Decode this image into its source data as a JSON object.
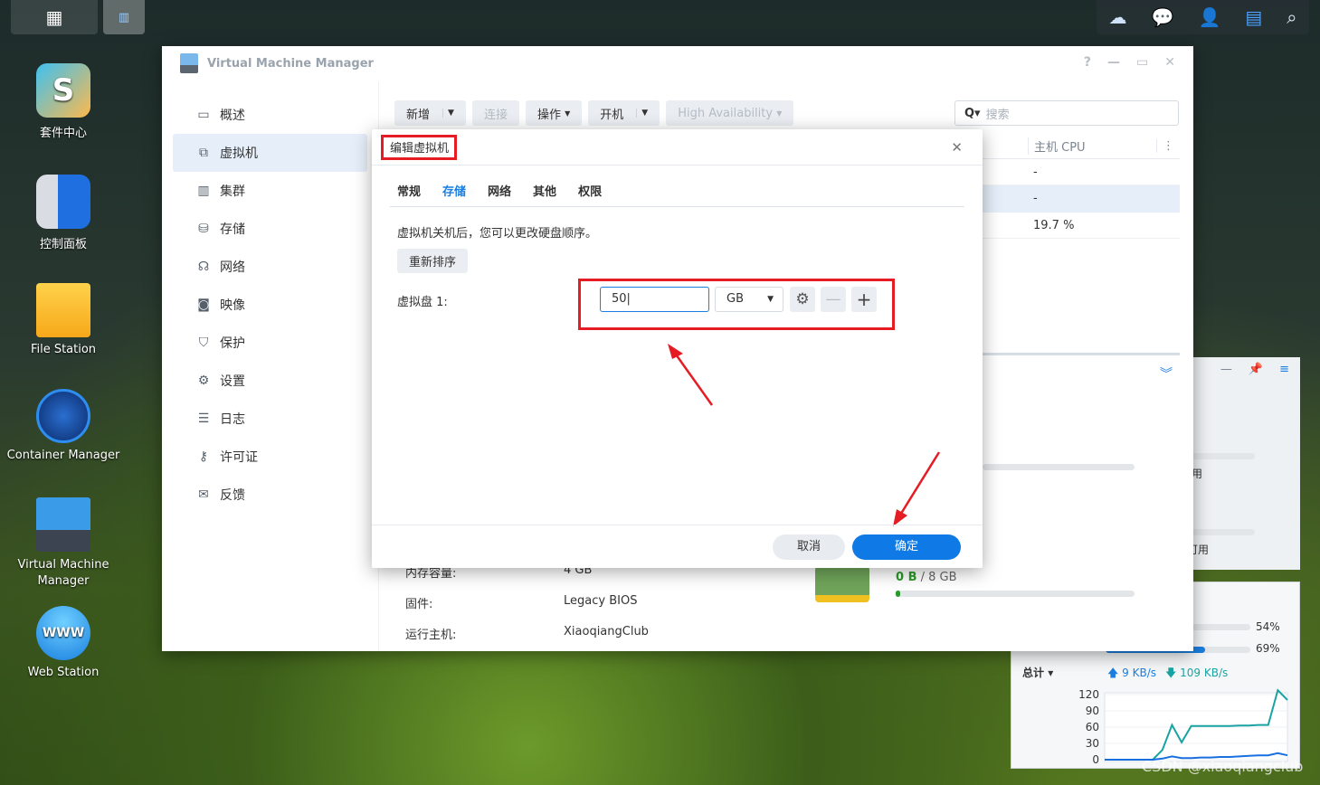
{
  "taskbar": {
    "tray_icons": [
      "cloud-sync-icon",
      "chat-icon",
      "user-icon",
      "widgets-icon",
      "search-icon"
    ]
  },
  "desktop": {
    "icons": [
      {
        "label": "套件中心"
      },
      {
        "label": "控制面板"
      },
      {
        "label": "File Station"
      },
      {
        "label": "Container Manager"
      },
      {
        "label": "Virtual Machine Manager"
      },
      {
        "label": "Web Station"
      }
    ]
  },
  "window": {
    "title": "Virtual Machine Manager",
    "sidebar": [
      {
        "label": "概述",
        "icon": "overview-icon"
      },
      {
        "label": "虚拟机",
        "icon": "vm-icon",
        "active": true
      },
      {
        "label": "集群",
        "icon": "cluster-icon"
      },
      {
        "label": "存储",
        "icon": "storage-icon"
      },
      {
        "label": "网络",
        "icon": "network-icon"
      },
      {
        "label": "映像",
        "icon": "image-icon"
      },
      {
        "label": "保护",
        "icon": "shield-icon"
      },
      {
        "label": "设置",
        "icon": "gear-icon"
      },
      {
        "label": "日志",
        "icon": "list-icon"
      },
      {
        "label": "许可证",
        "icon": "key-icon"
      },
      {
        "label": "反馈",
        "icon": "mail-icon"
      }
    ],
    "toolbar": {
      "create": "新增",
      "connect": "连接",
      "action": "操作",
      "power_on": "开机",
      "ha": "High Availability",
      "search_placeholder": "搜索"
    },
    "table": {
      "col_host_cpu": "主机 CPU",
      "rows": [
        "-",
        "-",
        "19.7 %"
      ]
    },
    "details": {
      "memory_label": "内存容量:",
      "memory_value": "4 GB",
      "firmware_label": "固件:",
      "firmware_value": "Legacy BIOS",
      "host_label": "运行主机:",
      "host_value": "XiaoqiangClub",
      "ram_used": "0 B",
      "ram_sep": "/",
      "ram_total": "8 GB"
    }
  },
  "dialog": {
    "title": "编辑虚拟机",
    "tabs": [
      "常规",
      "存储",
      "网络",
      "其他",
      "权限"
    ],
    "active_tab": "存储",
    "hint": "虚拟机关机后，您可以更改硬盘顺序。",
    "reorder": "重新排序",
    "disk_label": "虚拟盘 1:",
    "disk_size": "50",
    "disk_unit": "GB",
    "cancel": "取消",
    "ok": "确定"
  },
  "widget": {
    "partial1": "用",
    "partial2": "可用",
    "cpu_pct": "54%",
    "mem_pct": "69%",
    "cpu_fraction": 0.54,
    "mem_fraction": 0.69,
    "total_label": "总计",
    "upload": "9 KB/s",
    "download": "109 KB/s"
  },
  "chart_data": {
    "type": "line",
    "y_ticks": [
      "120",
      "90",
      "60",
      "30",
      "0"
    ],
    "ylim": [
      0,
      120
    ],
    "series": [
      {
        "color": "#1aa3a3",
        "values": [
          0,
          0,
          0,
          0,
          0,
          0,
          18,
          64,
          32,
          62,
          62,
          62,
          62,
          62,
          63,
          63,
          64,
          64,
          128,
          110
        ]
      },
      {
        "color": "#1a6fe0",
        "values": [
          0,
          0,
          0,
          0,
          0,
          0,
          2,
          6,
          3,
          3,
          4,
          4,
          5,
          5,
          6,
          7,
          8,
          8,
          12,
          8
        ]
      }
    ]
  },
  "watermark": "CSDN @xiaoqiangclub"
}
